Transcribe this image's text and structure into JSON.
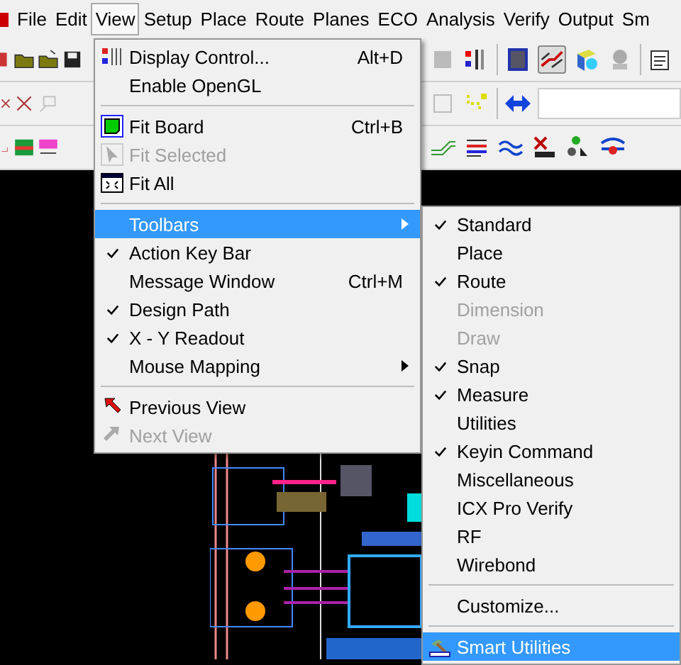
{
  "menubar": [
    {
      "label": "File",
      "selected": false
    },
    {
      "label": "Edit",
      "selected": false
    },
    {
      "label": "View",
      "selected": true
    },
    {
      "label": "Setup",
      "selected": false
    },
    {
      "label": "Place",
      "selected": false
    },
    {
      "label": "Route",
      "selected": false
    },
    {
      "label": "Planes",
      "selected": false
    },
    {
      "label": "ECO",
      "selected": false
    },
    {
      "label": "Analysis",
      "selected": false
    },
    {
      "label": "Verify",
      "selected": false
    },
    {
      "label": "Output",
      "selected": false
    },
    {
      "label": "Sm",
      "selected": false
    }
  ],
  "view_menu": {
    "items": [
      {
        "kind": "item",
        "label": "Display Control...",
        "shortcut": "Alt+D",
        "checked": false,
        "disabled": false,
        "selected": false,
        "submenu": false
      },
      {
        "kind": "item",
        "label": "Enable OpenGL",
        "checked": false,
        "disabled": false,
        "selected": false,
        "submenu": false
      },
      {
        "kind": "separator"
      },
      {
        "kind": "item",
        "label": "Fit Board",
        "shortcut": "Ctrl+B",
        "checked": false,
        "disabled": false,
        "selected": false,
        "submenu": false
      },
      {
        "kind": "item",
        "label": "Fit Selected",
        "checked": false,
        "disabled": true,
        "selected": false,
        "submenu": false
      },
      {
        "kind": "item",
        "label": "Fit All",
        "checked": false,
        "disabled": false,
        "selected": false,
        "submenu": false
      },
      {
        "kind": "separator"
      },
      {
        "kind": "item",
        "label": "Toolbars",
        "checked": false,
        "disabled": false,
        "selected": true,
        "submenu": true
      },
      {
        "kind": "item",
        "label": "Action Key Bar",
        "checked": true,
        "disabled": false,
        "selected": false,
        "submenu": false
      },
      {
        "kind": "item",
        "label": "Message Window",
        "shortcut": "Ctrl+M",
        "checked": false,
        "disabled": false,
        "selected": false,
        "submenu": false
      },
      {
        "kind": "item",
        "label": "Design Path",
        "checked": true,
        "disabled": false,
        "selected": false,
        "submenu": false
      },
      {
        "kind": "item",
        "label": "X - Y Readout",
        "checked": true,
        "disabled": false,
        "selected": false,
        "submenu": false
      },
      {
        "kind": "item",
        "label": "Mouse Mapping",
        "checked": false,
        "disabled": false,
        "selected": false,
        "submenu": true
      },
      {
        "kind": "separator"
      },
      {
        "kind": "item",
        "label": "Previous View",
        "checked": false,
        "disabled": false,
        "selected": false,
        "submenu": false
      },
      {
        "kind": "item",
        "label": "Next View",
        "checked": false,
        "disabled": true,
        "selected": false,
        "submenu": false
      }
    ]
  },
  "toolbars_submenu": {
    "items": [
      {
        "kind": "item",
        "label": "Standard",
        "checked": true,
        "disabled": false,
        "selected": false
      },
      {
        "kind": "item",
        "label": "Place",
        "checked": false,
        "disabled": false,
        "selected": false
      },
      {
        "kind": "item",
        "label": "Route",
        "checked": true,
        "disabled": false,
        "selected": false
      },
      {
        "kind": "item",
        "label": "Dimension",
        "checked": false,
        "disabled": true,
        "selected": false
      },
      {
        "kind": "item",
        "label": "Draw",
        "checked": false,
        "disabled": true,
        "selected": false
      },
      {
        "kind": "item",
        "label": "Snap",
        "checked": true,
        "disabled": false,
        "selected": false
      },
      {
        "kind": "item",
        "label": "Measure",
        "checked": true,
        "disabled": false,
        "selected": false
      },
      {
        "kind": "item",
        "label": "Utilities",
        "checked": false,
        "disabled": false,
        "selected": false
      },
      {
        "kind": "item",
        "label": "Keyin Command",
        "checked": true,
        "disabled": false,
        "selected": false
      },
      {
        "kind": "item",
        "label": "Miscellaneous",
        "checked": false,
        "disabled": false,
        "selected": false
      },
      {
        "kind": "item",
        "label": "ICX Pro Verify",
        "checked": false,
        "disabled": false,
        "selected": false
      },
      {
        "kind": "item",
        "label": "RF",
        "checked": false,
        "disabled": false,
        "selected": false
      },
      {
        "kind": "item",
        "label": "Wirebond",
        "checked": false,
        "disabled": false,
        "selected": false
      },
      {
        "kind": "separator"
      },
      {
        "kind": "item",
        "label": "Customize...",
        "checked": false,
        "disabled": false,
        "selected": false
      },
      {
        "kind": "separator"
      },
      {
        "kind": "item",
        "label": "Smart Utilities",
        "checked": false,
        "disabled": false,
        "selected": true
      }
    ]
  }
}
